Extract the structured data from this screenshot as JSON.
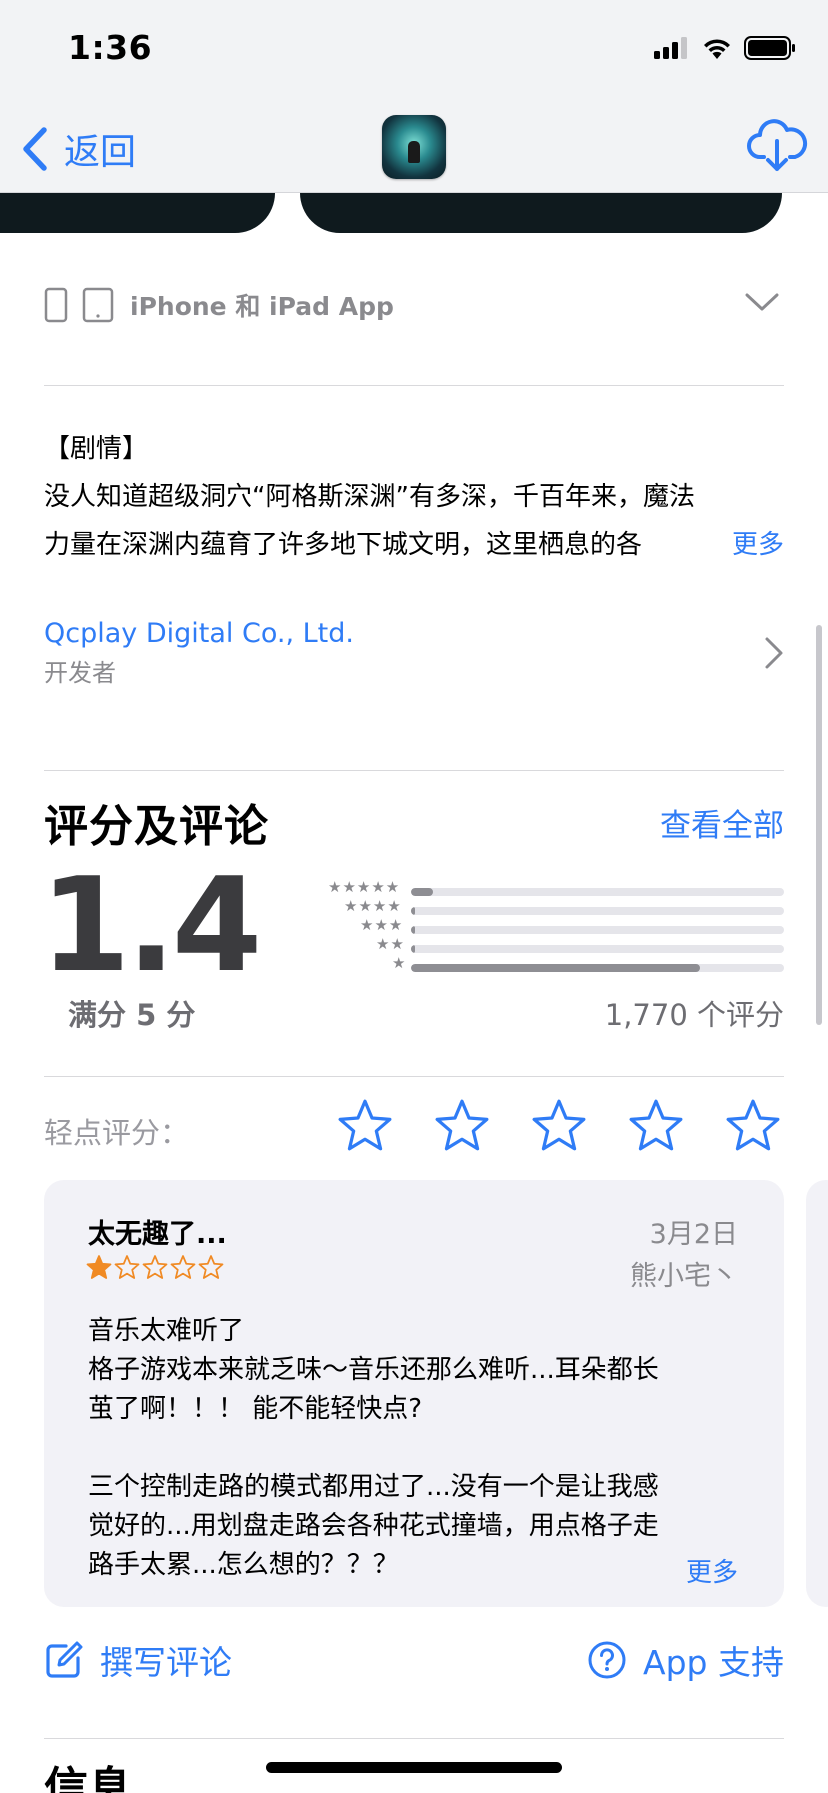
{
  "status": {
    "time": "1:36"
  },
  "nav": {
    "back_label": "返回"
  },
  "device": {
    "label": "iPhone 和 iPad App"
  },
  "description": {
    "line1": "【剧情】",
    "line2": "没人知道超级洞穴“阿格斯深渊”有多深，千百年来，魔法",
    "line3": "力量在深渊内蕴育了许多地下城文明，这里栖息的各",
    "more": "更多"
  },
  "developer": {
    "name": "Qcplay Digital Co., Ltd.",
    "role": "开发者"
  },
  "ratings": {
    "title": "评分及评论",
    "see_all": "查看全部",
    "average": "1.4",
    "out_of": "满分 5 分",
    "count": "1,770 个评分",
    "histogram": [
      {
        "stars": "★★★★★",
        "fraction": 0.06
      },
      {
        "stars": "★★★★",
        "fraction": 0.006
      },
      {
        "stars": "★★★",
        "fraction": 0.006
      },
      {
        "stars": "★★",
        "fraction": 0.01
      },
      {
        "stars": "★",
        "fraction": 0.775
      }
    ]
  },
  "tap_to_rate": {
    "label": "轻点评分：",
    "max_stars": 5
  },
  "review": {
    "title": "太无趣了...",
    "date": "3月2日",
    "author": "熊小宅丶",
    "rating": 1,
    "body": "音乐太难听了\n格子游戏本来就乏味～音乐还那么难听...耳朵都长\n茧了啊！！！ 能不能轻快点?\n\n三个控制走路的模式都用过了...没有一个是让我感\n觉好的...用划盘走路会各种花式撞墙，用点格子走\n路手太累...怎么想的？？？",
    "more": "更多"
  },
  "actions": {
    "write_review": "撰写评论",
    "app_support": "App 支持"
  },
  "info": {
    "title": "信息"
  },
  "colors": {
    "accent": "#2f7cf6",
    "review_star": "#f08a24"
  }
}
